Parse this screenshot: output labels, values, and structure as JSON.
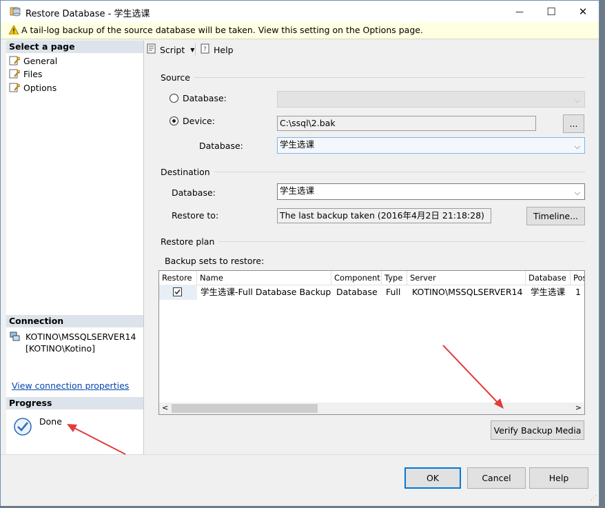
{
  "window": {
    "title": "Restore Database - 学生选课",
    "minimize_glyph": "—",
    "maximize_glyph": "☐",
    "close_glyph": "✕"
  },
  "warning": {
    "text": "A tail-log backup of the source database will be taken. View this setting on the Options page."
  },
  "left": {
    "select_page_header": "Select a page",
    "pages": [
      {
        "label": "General"
      },
      {
        "label": "Files"
      },
      {
        "label": "Options"
      }
    ],
    "connection_header": "Connection",
    "connection_server": "KOTINO\\MSSQLSERVER14",
    "connection_user": "[KOTINO\\Kotino]",
    "view_connection_link": "View connection properties",
    "progress_header": "Progress",
    "progress_status": "Done"
  },
  "toolbar": {
    "script_label": "Script",
    "help_label": "Help"
  },
  "source": {
    "group_label": "Source",
    "database_radio_label": "Database:",
    "device_radio_label": "Device:",
    "device_value": "C:\\ssql\\2.bak",
    "browse_label": "...",
    "database_label": "Database:",
    "database_value": "学生选课"
  },
  "destination": {
    "group_label": "Destination",
    "database_label": "Database:",
    "database_value": "学生选课",
    "restore_to_label": "Restore to:",
    "restore_to_value": "The last backup taken (2016年4月2日 21:18:28)",
    "timeline_label": "Timeline..."
  },
  "restore_plan": {
    "group_label": "Restore plan",
    "backup_sets_label": "Backup sets to restore:",
    "columns": [
      "Restore",
      "Name",
      "Component",
      "Type",
      "Server",
      "Database",
      "Pos"
    ],
    "rows": [
      {
        "restore_checked": true,
        "name": "学生选课-Full Database Backup",
        "component": "Database",
        "type": "Full",
        "server": "KOTINO\\MSSQLSERVER14",
        "database": "学生选课",
        "position": "1"
      }
    ],
    "scroll_left_glyph": "<",
    "scroll_right_glyph": ">",
    "verify_label": "Verify Backup Media"
  },
  "footer": {
    "ok_label": "OK",
    "cancel_label": "Cancel",
    "help_label": "Help"
  },
  "colors": {
    "annotation_arrow": "#e23b3b",
    "warning_background": "#ffffe1",
    "link": "#0645ad"
  }
}
